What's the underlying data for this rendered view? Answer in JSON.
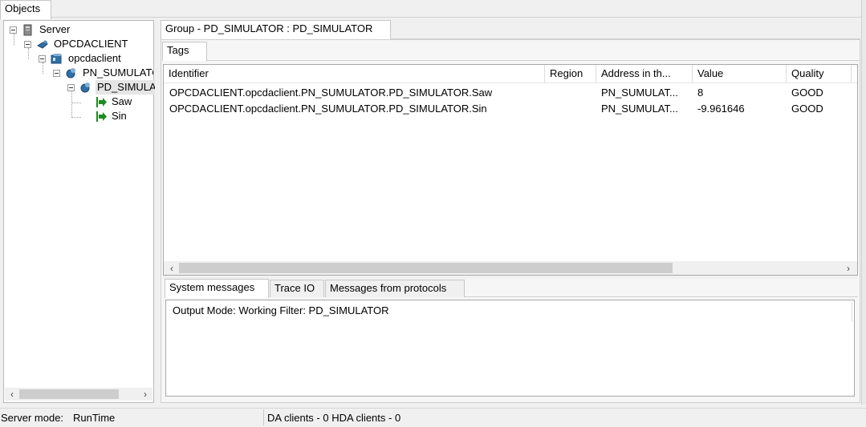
{
  "objects_tab": "Objects",
  "tree": {
    "server": "Server",
    "opcdaclient_upper": "OPCDACLIENT",
    "opcdaclient_lower": "opcdaclient",
    "pn_simulator": "PN_SUMULATOR",
    "pd_simulator": "PD_SIMULATOR",
    "saw": "Saw",
    "sin": "Sin"
  },
  "group_tab": "Group - PD_SIMULATOR : PD_SIMULATOR",
  "tags_tab": "Tags",
  "table": {
    "columns": [
      "Identifier",
      "Region",
      "Address in th...",
      "Value",
      "Quality"
    ],
    "rows": [
      {
        "identifier": "OPCDACLIENT.opcdaclient.PN_SUMULATOR.PD_SIMULATOR.Saw",
        "region": "",
        "address": "PN_SUMULAT...",
        "value": "8",
        "quality": "GOOD"
      },
      {
        "identifier": "OPCDACLIENT.opcdaclient.PN_SUMULATOR.PD_SIMULATOR.Sin",
        "region": "",
        "address": "PN_SUMULAT...",
        "value": "-9.961646",
        "quality": "GOOD"
      }
    ]
  },
  "messages_tabs": [
    "System messages",
    "Trace IO",
    "Messages from protocols"
  ],
  "output_text": "Output Mode: Working Filter: PD_SIMULATOR",
  "status": {
    "server_mode_label": "Server mode:",
    "server_mode_value": "RunTime",
    "clients": "DA clients - 0 HDA clients - 0"
  },
  "icons": {
    "server": "server-icon",
    "client": "client-icon",
    "device": "device-icon",
    "group": "group-icon",
    "tag": "tag-arrow-icon"
  },
  "colors": {
    "tag_arrow": "#1f8a1f",
    "selected_bg": "#e5e5e5",
    "icon_blue": "#2f6fa8"
  }
}
